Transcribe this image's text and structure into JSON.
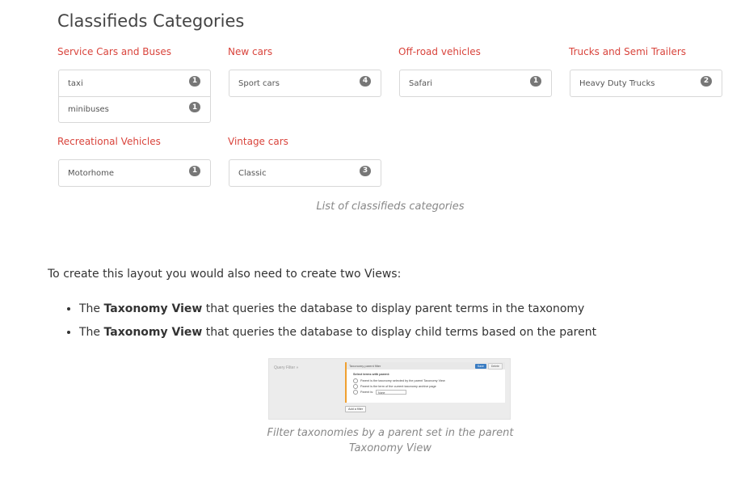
{
  "heading": "Classifieds Categories",
  "categories": [
    {
      "title": "Service Cars and Buses",
      "items": [
        {
          "label": "taxi",
          "count": "1"
        },
        {
          "label": "minibuses",
          "count": "1"
        }
      ]
    },
    {
      "title": "New cars",
      "items": [
        {
          "label": "Sport cars",
          "count": "4"
        }
      ]
    },
    {
      "title": "Off-road vehicles",
      "items": [
        {
          "label": "Safari",
          "count": "1"
        }
      ]
    },
    {
      "title": "Trucks and Semi Trailers",
      "items": [
        {
          "label": "Heavy Duty Trucks",
          "count": "2"
        }
      ]
    },
    {
      "title": "Recreational Vehicles",
      "items": [
        {
          "label": "Motorhome",
          "count": "1"
        }
      ]
    },
    {
      "title": "Vintage cars",
      "items": [
        {
          "label": "Classic",
          "count": "3"
        }
      ]
    }
  ],
  "caption1": "List of classifieds categories",
  "paragraph": "To create this layout you would also need to create two Views:",
  "bullets": [
    {
      "bold": "Taxonomy View",
      "pre": "The ",
      "post": " that queries the database to display parent terms in the taxonomy"
    },
    {
      "bold": "Taxonomy View",
      "pre": "The ",
      "post": " that queries the database to display child terms based on the parent"
    }
  ],
  "screenshot": {
    "section_label": "Query Filter",
    "panel_title": "Taxonomy parent filter",
    "save": "Save",
    "delete": "Delete",
    "select_label": "Select terms with parent:",
    "option1": "Parent is the taxonomy selected by the parent Taxonomy View",
    "option2": "Parent is the term of the current taxonomy archive page",
    "option3": "Parent is:",
    "option3_value": "None",
    "add_filter": "Add a filter"
  },
  "caption2_line1": "Filter taxonomies by a parent set in the parent",
  "caption2_line2": "Taxonomy View"
}
